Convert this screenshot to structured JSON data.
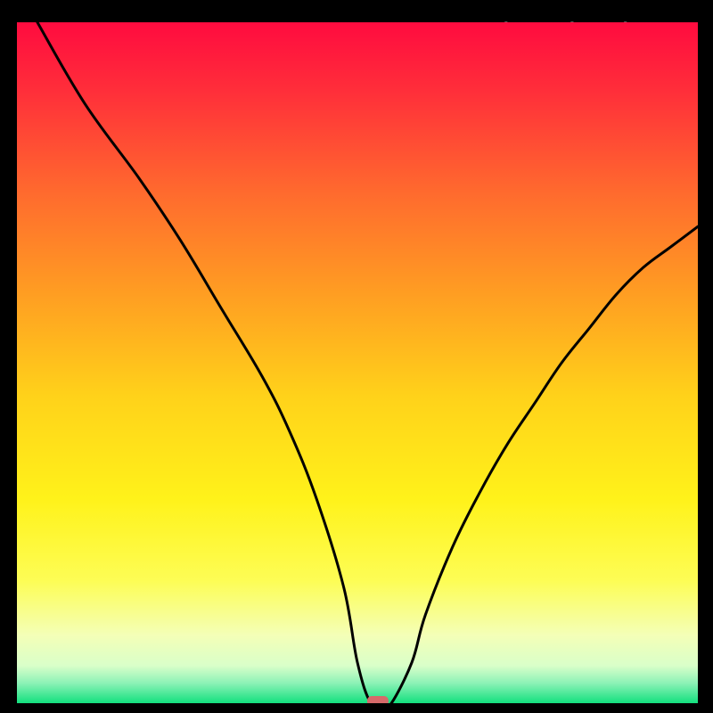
{
  "watermark": "TheBottleneck.com",
  "chart_data": {
    "type": "line",
    "title": "",
    "xlabel": "",
    "ylabel": "",
    "xlim": [
      0,
      100
    ],
    "ylim": [
      0,
      100
    ],
    "grid": false,
    "legend": false,
    "series": [
      {
        "name": "bottleneck-curve",
        "x": [
          3,
          10,
          18,
          24,
          30,
          36,
          40,
          44,
          48,
          50,
          52,
          54,
          55,
          58,
          60,
          64,
          68,
          72,
          76,
          80,
          84,
          88,
          92,
          96,
          100
        ],
        "y": [
          100,
          88,
          77,
          68,
          58,
          48,
          40,
          30,
          17,
          6,
          0,
          0,
          0,
          6,
          13,
          23,
          31,
          38,
          44,
          50,
          55,
          60,
          64,
          67,
          70
        ]
      }
    ],
    "marker": {
      "x": 53,
      "y": 0,
      "color": "#d66a6a"
    },
    "gradient_stops": [
      {
        "offset": 0.0,
        "color": "#ff0b3f"
      },
      {
        "offset": 0.1,
        "color": "#ff2e3a"
      },
      {
        "offset": 0.25,
        "color": "#ff6a2e"
      },
      {
        "offset": 0.4,
        "color": "#ff9e22"
      },
      {
        "offset": 0.55,
        "color": "#ffd21a"
      },
      {
        "offset": 0.7,
        "color": "#fff21a"
      },
      {
        "offset": 0.82,
        "color": "#fdfd55"
      },
      {
        "offset": 0.9,
        "color": "#f4ffb7"
      },
      {
        "offset": 0.945,
        "color": "#d9ffc9"
      },
      {
        "offset": 0.97,
        "color": "#8ef2b7"
      },
      {
        "offset": 1.0,
        "color": "#13e07e"
      }
    ]
  }
}
